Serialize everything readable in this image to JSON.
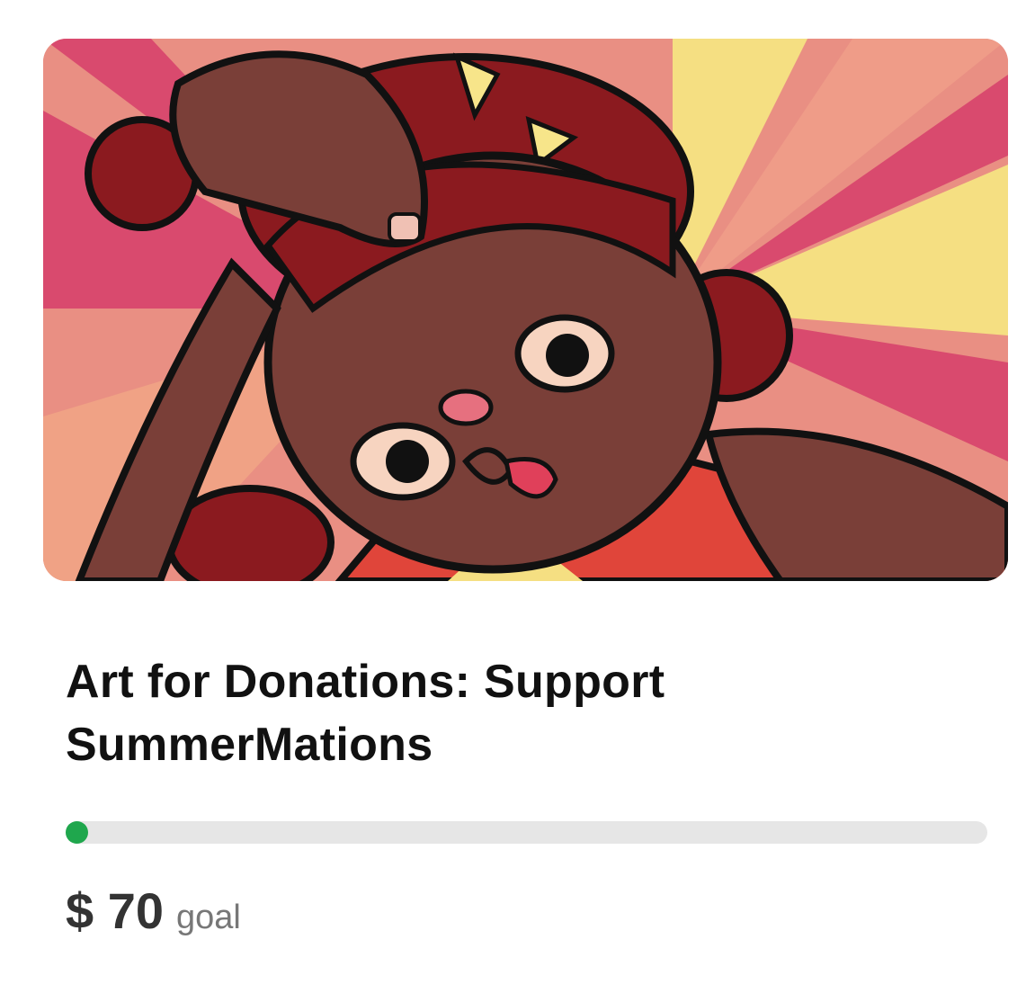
{
  "campaign": {
    "image_alt": "Cartoon illustration of a girl with red curly hair pulling a silly face",
    "title": "Art for Donations: Support SummerMations",
    "progress_fraction": 0.0,
    "amount": "$ 70",
    "goal_label": "goal"
  },
  "colors": {
    "progress_fill": "#1fa74d",
    "progress_track": "#e6e6e6",
    "title": "#111111",
    "amount": "#333333",
    "goal_label": "#777777"
  }
}
